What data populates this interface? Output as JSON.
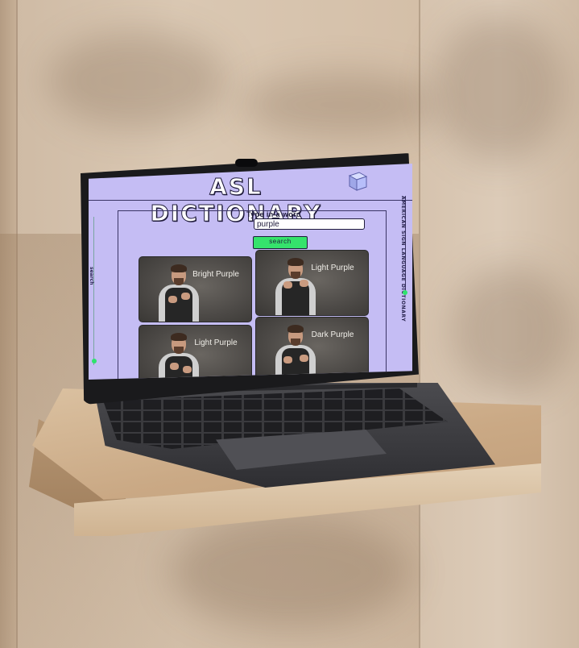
{
  "app": {
    "title": "ASL DICTIONARY",
    "side_caption": "AMERICAN SIGN LANGUAGE DICTIONARY",
    "left_caption": "search"
  },
  "search": {
    "label": "Type in a word",
    "value": "purple",
    "button_label": "search"
  },
  "results": [
    {
      "word": "Bright Purple"
    },
    {
      "word": "Light Purple"
    },
    {
      "word": "Light Purple"
    },
    {
      "word": "Dark Purple"
    }
  ],
  "colors": {
    "screen_bg": "#c5bdf4",
    "accent_green": "#35e36c",
    "ink": "#1f1b3b"
  },
  "icons": [
    "cube-logo-icon"
  ]
}
